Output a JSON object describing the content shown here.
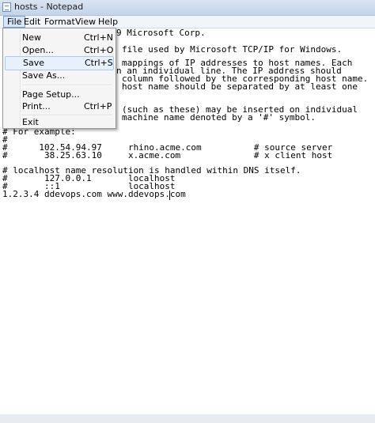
{
  "window": {
    "title": "hosts - Notepad"
  },
  "menubar": [
    "File",
    "Edit",
    "Format",
    "View",
    "Help"
  ],
  "file_menu": [
    {
      "label": "New",
      "shortcut": "Ctrl+N"
    },
    {
      "label": "Open...",
      "shortcut": "Ctrl+O"
    },
    {
      "label": "Save",
      "shortcut": "Ctrl+S",
      "highlighted": true
    },
    {
      "label": "Save As...",
      "shortcut": ""
    },
    {
      "label": "Page Setup...",
      "shortcut": ""
    },
    {
      "label": "Print...",
      "shortcut": "Ctrl+P"
    },
    {
      "label": "Exit",
      "shortcut": ""
    }
  ],
  "editor": {
    "lines": [
      {
        "text": "9 Microsoft Corp."
      },
      {
        "text": ""
      },
      {
        "text": "file used by Microsoft TCP/IP for Windows."
      },
      {
        "text": ""
      },
      {
        "text": "mappings of IP addresses to host names. Each"
      },
      {
        "text": "n an individual line. The IP address should"
      },
      {
        "text": "column followed by the corresponding host name."
      },
      {
        "text": "host name should be separated by at least one"
      },
      {
        "text": ""
      },
      {
        "text": ""
      },
      {
        "text": "(such as these) may be inserted on individual"
      },
      {
        "text": "machine name denoted by a '#' symbol."
      },
      {
        "text": ""
      },
      {
        "text": "# For example:"
      },
      {
        "text": "#"
      },
      {
        "text": "#      102.54.94.97     rhino.acme.com          # source server"
      },
      {
        "text": "#       38.25.63.10     x.acme.com              # x client host"
      },
      {
        "text": ""
      },
      {
        "text": "# localhost name resolution is handled within DNS itself."
      },
      {
        "text": "#       127.0.0.1       localhost"
      },
      {
        "text": "#       ::1             localhost"
      },
      {
        "text": "1.2.3.4 ddevops.com www.ddevops.com"
      }
    ]
  }
}
